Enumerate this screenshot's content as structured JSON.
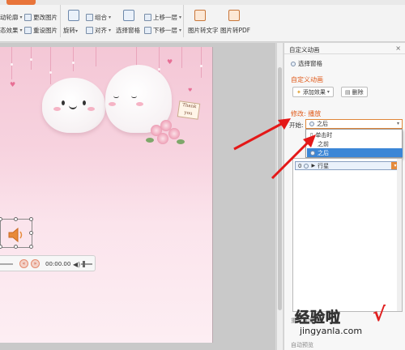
{
  "ribbon": {
    "left_col": [
      "动轮廓",
      "态效果"
    ],
    "picture_col": [
      "更改图片",
      "重设图片"
    ],
    "rotate": "旋转",
    "group": "组合",
    "align": "对齐",
    "select_pane": "选择窗格",
    "bring_forward": "上移一层",
    "send_backward": "下移一层",
    "img_to_text": "图片转文字",
    "img_to_pdf": "图片转PDF"
  },
  "slide": {
    "card_text": "Thank you",
    "player_time": "00:00.00"
  },
  "pane": {
    "title": "自定义动画",
    "close": "×",
    "select_pane": "选择窗格",
    "custom_anim_title": "自定义动画",
    "add_effect": "添加效果",
    "delete": "删除",
    "modify_title": "修改: 播放",
    "start_label": "开始:",
    "start_value": "之后",
    "options": [
      {
        "label": "单击时",
        "selected": false
      },
      {
        "label": "之前",
        "selected": false
      },
      {
        "label": "之后",
        "selected": true
      }
    ],
    "list_index": "0",
    "list_item": "行星",
    "faint_bottom_1": "重新排序",
    "faint_bottom_2": "自动预览"
  },
  "watermark": {
    "cn": "经验啦",
    "check": "√",
    "url": "jingyanla.com"
  },
  "colors": {
    "accent_orange": "#e05a1a",
    "selected_blue": "#3b86d6",
    "arrow_red": "#e41818"
  }
}
